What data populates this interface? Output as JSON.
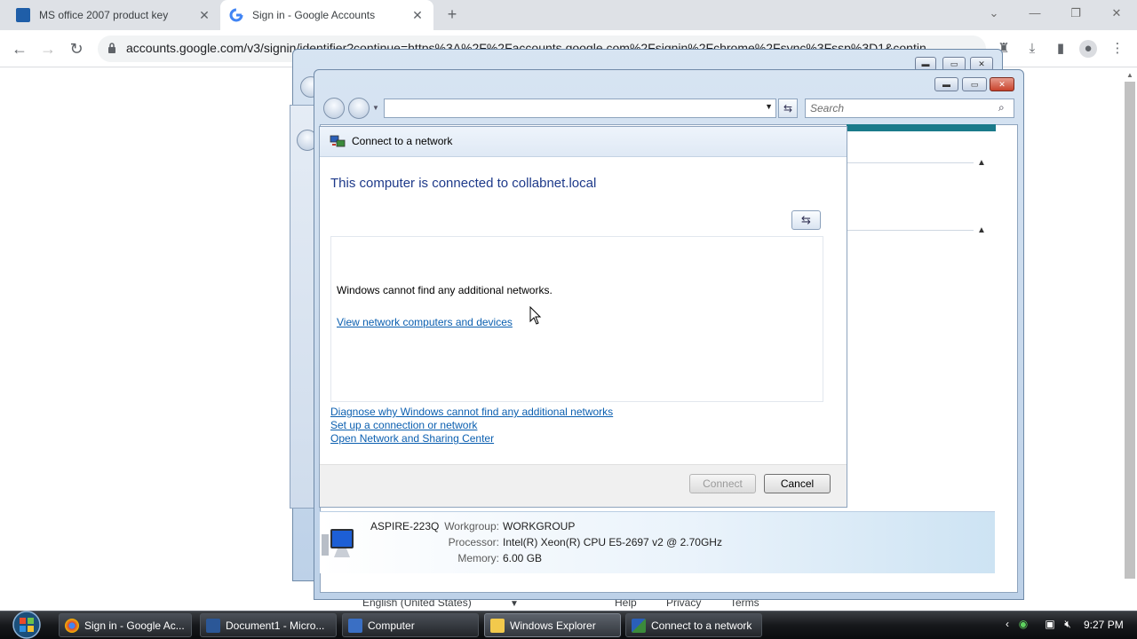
{
  "browser": {
    "tabs": [
      {
        "title": "MS office 2007 product key",
        "active": false
      },
      {
        "title": "Sign in - Google Accounts",
        "active": true
      }
    ],
    "new_tab": "+",
    "url": "accounts.google.com/v3/signin/identifier?continue=https%3A%2F%2Faccounts.google.com%2Fsignin%2Fchrome%2Fsync%3Fssp%3D1&continue"
  },
  "google_footer": {
    "language": "English (United States)",
    "help": "Help",
    "privacy": "Privacy",
    "terms": "Terms"
  },
  "explorer": {
    "search_placeholder": "Search",
    "system": {
      "computer_name": "ASPIRE-223Q",
      "workgroup_label": "Workgroup:",
      "workgroup": "WORKGROUP",
      "processor_label": "Processor:",
      "processor": "Intel(R) Xeon(R) CPU E5-2697 v2 @ 2.70GHz",
      "memory_label": "Memory:",
      "memory": "6.00 GB"
    }
  },
  "dialog": {
    "title": "Connect to a network",
    "heading": "This computer is connected to collabnet.local",
    "empty_message": "Windows cannot find any additional networks.",
    "view_link": "View network computers and devices",
    "links": [
      "Diagnose why Windows cannot find any additional networks",
      "Set up a connection or network",
      "Open Network and Sharing Center"
    ],
    "connect_label": "Connect",
    "cancel_label": "Cancel"
  },
  "taskbar": {
    "items": [
      {
        "label": "Sign in - Google Ac...",
        "active": false
      },
      {
        "label": "Document1 - Micro...",
        "active": false
      },
      {
        "label": "Computer",
        "active": false
      },
      {
        "label": "Windows Explorer",
        "active": true
      },
      {
        "label": "Connect to a network",
        "active": false
      }
    ],
    "clock": "9:27 PM"
  }
}
